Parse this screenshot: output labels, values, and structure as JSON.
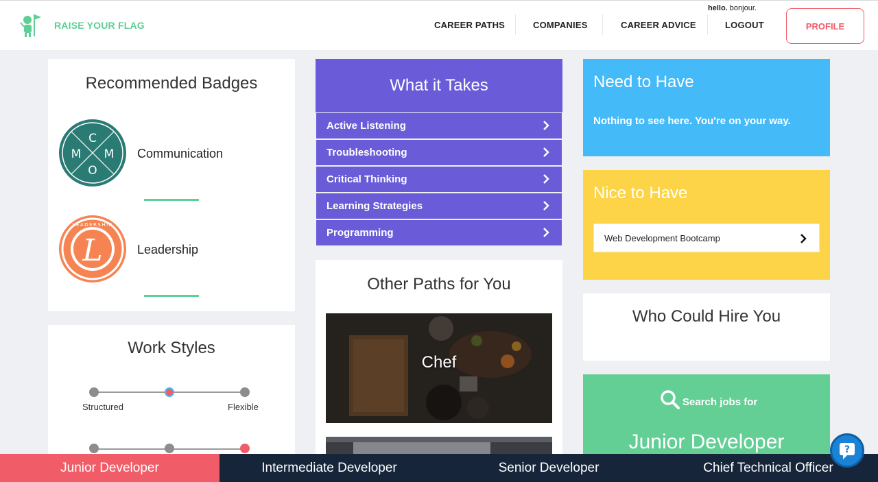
{
  "header": {
    "brand": "RAISE YOUR FLAG",
    "nav": [
      "CAREER PATHS",
      "COMPANIES",
      "CAREER ADVICE",
      "LOGOUT"
    ],
    "hello_bold": "hello.",
    "hello_rest": " bonjour.",
    "profile_label": "PROFILE"
  },
  "badges": {
    "title": "Recommended Badges",
    "items": [
      {
        "label": "Communication",
        "letters": [
          "C",
          "M",
          "M",
          "O"
        ],
        "color": "#2a7b73"
      },
      {
        "label": "Leadership",
        "letter": "L",
        "ring_text": "LEADERSHIP",
        "color": "#f58452"
      }
    ]
  },
  "work_styles": {
    "title": "Work Styles",
    "left_label": "Structured",
    "right_label": "Flexible"
  },
  "what_it_takes": {
    "title": "What it Takes",
    "items": [
      "Active Listening",
      "Troubleshooting",
      "Critical Thinking",
      "Learning Strategies",
      "Programming"
    ]
  },
  "other_paths": {
    "title": "Other Paths for You",
    "items": [
      "Chef"
    ]
  },
  "need_to_have": {
    "title": "Need to Have",
    "text": "Nothing to see here. You're on your way."
  },
  "nice_to_have": {
    "title": "Nice to Have",
    "items": [
      "Web Development Bootcamp"
    ]
  },
  "who_could_hire": {
    "title": "Who Could Hire You"
  },
  "search_jobs": {
    "label": "Search jobs for",
    "role": "Junior Developer"
  },
  "bottom_tabs": [
    "Junior Developer",
    "Intermediate Developer",
    "Senior Developer",
    "Chief Technical Officer"
  ],
  "colors": {
    "brand_green": "#5ecf95",
    "purple": "#6a5cd8",
    "blue": "#45baf9",
    "yellow": "#fdd447",
    "green": "#63cf94",
    "red": "#f05d68",
    "navy": "#16253a"
  }
}
